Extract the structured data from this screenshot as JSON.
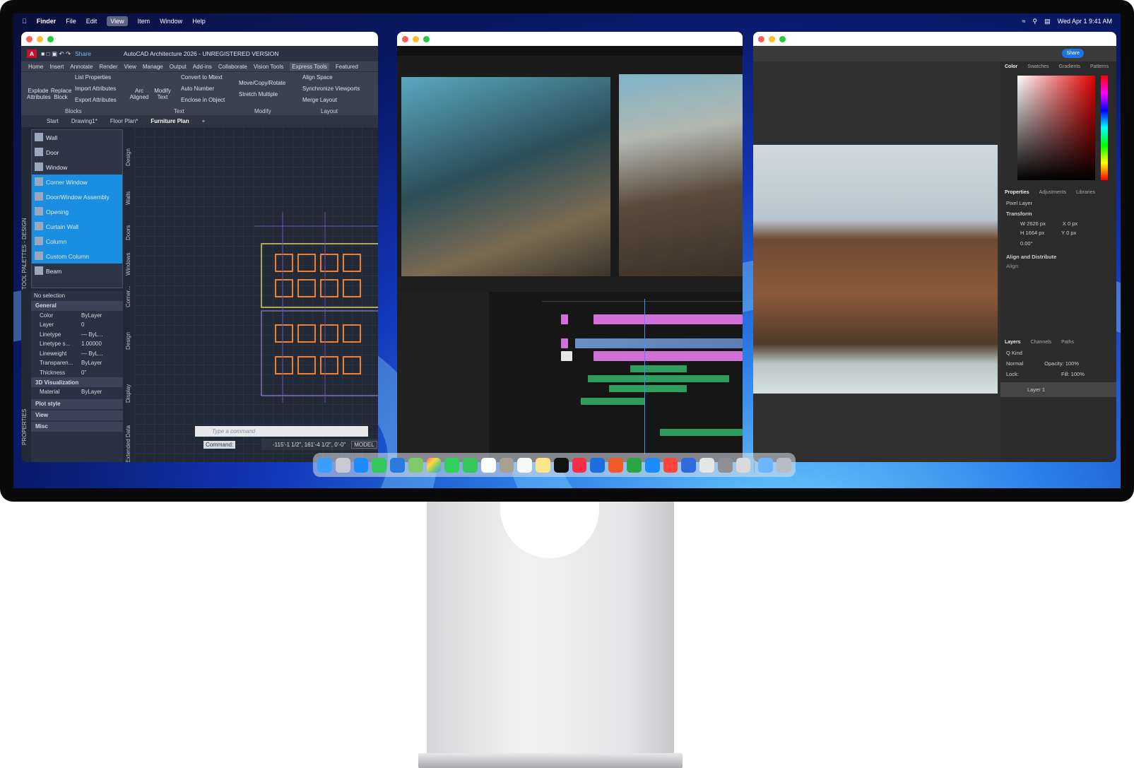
{
  "menubar": {
    "app": "Finder",
    "items": [
      "File",
      "Edit",
      "View",
      "Item",
      "Window",
      "Help"
    ],
    "selected": "View",
    "clock": "Wed Apr 1  9:41 AM"
  },
  "autocad": {
    "title": "AutoCAD Architecture 2026 - UNREGISTERED VERSION",
    "share": "Share",
    "tabs": [
      "Home",
      "Insert",
      "Annotate",
      "Render",
      "View",
      "Manage",
      "Output",
      "Add-ins",
      "Collaborate",
      "Vision Tools",
      "Express Tools",
      "Featured"
    ],
    "active_tab": "Express Tools",
    "ribbon": {
      "explode": "Explode\nAttributes",
      "replace": "Replace\nBlock",
      "list_props": "List Properties",
      "import_attr": "Import Attributes",
      "export_attr": "Export Attributes",
      "arc_aligned": "Arc\nAligned",
      "modify_text": "Modify\nText",
      "convert_mtext": "Convert to Mtext",
      "auto_number": "Auto Number",
      "enclose": "Enclose in Object",
      "move_copy": "Move/Copy/Rotate",
      "stretch": "Stretch Multiple",
      "align_space": "Align Space",
      "sync_vp": "Synchronize Viewports",
      "merge_layout": "Merge Layout",
      "groups": [
        "Blocks",
        "Text",
        "Modify",
        "Layout"
      ]
    },
    "doctabs": [
      "Start",
      "Drawing1*",
      "Floor Plan*",
      "Furniture Plan"
    ],
    "palette": [
      "Wall",
      "Door",
      "Window",
      "Corner Window",
      "Door/Window Assembly",
      "Opening",
      "Curtain Wall",
      "Column",
      "Custom Column",
      "Beam"
    ],
    "palette_highlighted": [
      3,
      4,
      5,
      6,
      7,
      8
    ],
    "side_tabs": [
      "Design",
      "Walls",
      "Doors",
      "Windows",
      "Corner...",
      "Design",
      "Display",
      "Extended Data"
    ],
    "left_tabs": [
      "TOOL PALETTES - DESIGN",
      "PROPERTIES"
    ],
    "selection": "No selection",
    "props": {
      "general": "General",
      "rows": [
        [
          "Color",
          "ByLayer"
        ],
        [
          "Layer",
          "0"
        ],
        [
          "Linetype",
          "— ByL..."
        ],
        [
          "Linetype s...",
          "1.00000"
        ],
        [
          "Lineweight",
          "— ByL..."
        ],
        [
          "Transparen...",
          "ByLayer"
        ],
        [
          "Thickness",
          "0\""
        ]
      ],
      "viz": "3D Visualization",
      "viz_rows": [
        [
          "Material",
          "ByLayer"
        ]
      ],
      "sections": [
        "Plot style",
        "View",
        "Misc"
      ]
    },
    "command_label": "Command:",
    "command_placeholder": "Type a command",
    "coords": "-115'-1 1/2\", 161'-4 1/2\", 0'-0\"",
    "model": "MODEL"
  },
  "photoshop": {
    "share": "Share",
    "color_tabs": [
      "Color",
      "Swatches",
      "Gradients",
      "Patterns"
    ],
    "prop_tabs": [
      "Properties",
      "Adjustments",
      "Libraries"
    ],
    "pixel_layer": "Pixel Layer",
    "transform": "Transform",
    "w": "W 2626 px",
    "h": "H 1664 px",
    "x": "X 0 px",
    "y": "Y 0 px",
    "angle": "0.00°",
    "align": "Align and Distribute",
    "align_label": "Align:",
    "layer_tabs": [
      "Layers",
      "Channels",
      "Paths"
    ],
    "kind": "Q Kind",
    "blend": "Normal",
    "opacity": "Opacity: 100%",
    "lock": "Lock:",
    "fill": "Fill: 100%",
    "layer": "Layer 1"
  }
}
